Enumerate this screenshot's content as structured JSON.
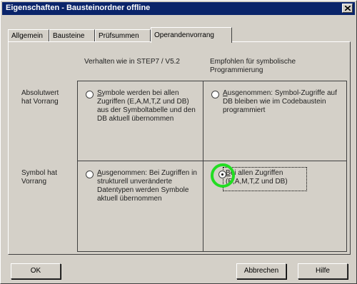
{
  "window": {
    "title": "Eigenschaften - Bausteinordner offline"
  },
  "tabs": [
    {
      "label": "Allgemein"
    },
    {
      "label": "Bausteine"
    },
    {
      "label": "Prüfsummen"
    },
    {
      "label": "Operandenvorrang",
      "active": true
    }
  ],
  "columns": {
    "left_header": "Verhalten wie in STEP7 / V5.2",
    "right_header": "Empfohlen für symbolische Programmierung"
  },
  "rows": {
    "row1_label": "Absolutwert hat Vorrang",
    "row2_label": "Symbol hat Vorrang"
  },
  "options": {
    "r1_left": "Symbole werden bei allen Zugriffen (E,A,M,T,Z und DB) aus der Symboltabelle und den DB aktuell übernommen",
    "r1_right": "Ausgenommen: Symbol-Zugriffe auf DB bleiben wie im Codebaustein programmiert",
    "r2_left": "Ausgenommen: Bei Zugriffen in strukturell unveränderte Datentypen werden Symbole aktuell übernommen",
    "r2_right": "Bei allen Zugriffen (E,A,M,T,Z und DB)"
  },
  "selected_option": "r2_right",
  "buttons": {
    "ok": "OK",
    "cancel": "Abbrechen",
    "help": "Hilfe"
  },
  "colors": {
    "titlebar": "#0a246a",
    "highlight": "#22dd22"
  }
}
